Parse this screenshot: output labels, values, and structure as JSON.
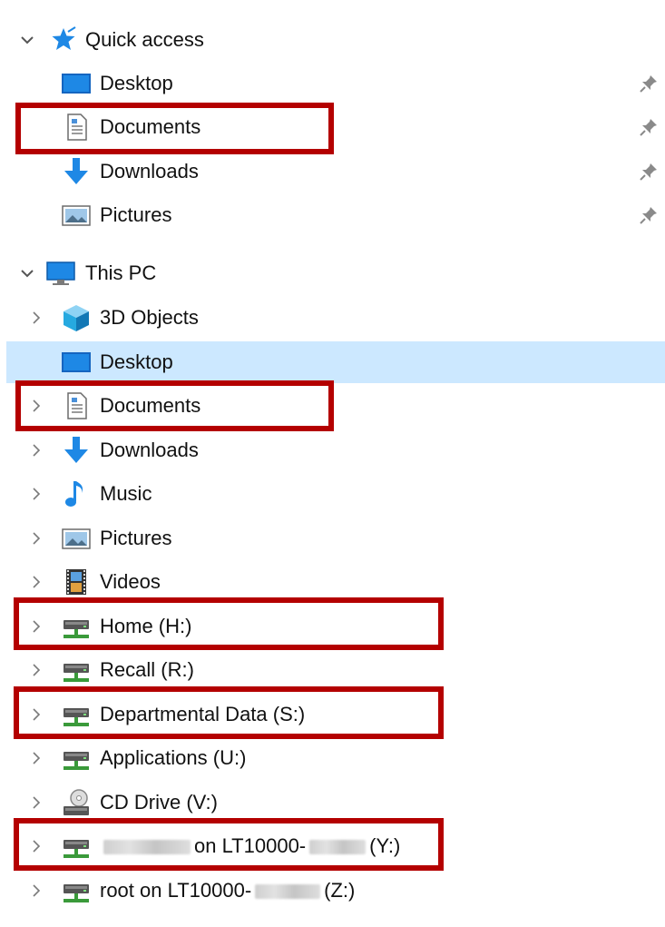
{
  "quick_access": {
    "header_label": "Quick access",
    "items": [
      {
        "label": "Desktop",
        "icon": "desktop-icon"
      },
      {
        "label": "Documents",
        "icon": "documents-icon"
      },
      {
        "label": "Downloads",
        "icon": "downloads-icon"
      },
      {
        "label": "Pictures",
        "icon": "pictures-icon"
      }
    ]
  },
  "this_pc": {
    "header_label": "This PC",
    "items": [
      {
        "label": "3D Objects",
        "icon": "3d-objects-icon"
      },
      {
        "label": "Desktop",
        "icon": "desktop-icon",
        "selected": true
      },
      {
        "label": "Documents",
        "icon": "documents-icon"
      },
      {
        "label": "Downloads",
        "icon": "downloads-icon"
      },
      {
        "label": "Music",
        "icon": "music-icon"
      },
      {
        "label": "Pictures",
        "icon": "pictures-icon"
      },
      {
        "label": "Videos",
        "icon": "videos-icon"
      },
      {
        "label": "Home (H:)",
        "icon": "network-drive-icon"
      },
      {
        "label": "Recall (R:)",
        "icon": "network-drive-icon"
      },
      {
        "label": "Departmental Data (S:)",
        "icon": "network-drive-icon"
      },
      {
        "label": "Applications (U:)",
        "icon": "network-drive-icon"
      },
      {
        "label": "CD Drive (V:)",
        "icon": "cd-drive-icon"
      },
      {
        "label_parts": [
          "on LT10000-",
          "(Y:)"
        ],
        "icon": "network-drive-icon",
        "redacted": true
      },
      {
        "label_parts": [
          "root on LT10000-",
          "(Z:)"
        ],
        "icon": "network-drive-icon",
        "redacted": true
      }
    ]
  },
  "colors": {
    "selection_background": "#cce8ff",
    "highlight_border": "#b40000",
    "chevron": "#6e6e6e"
  }
}
